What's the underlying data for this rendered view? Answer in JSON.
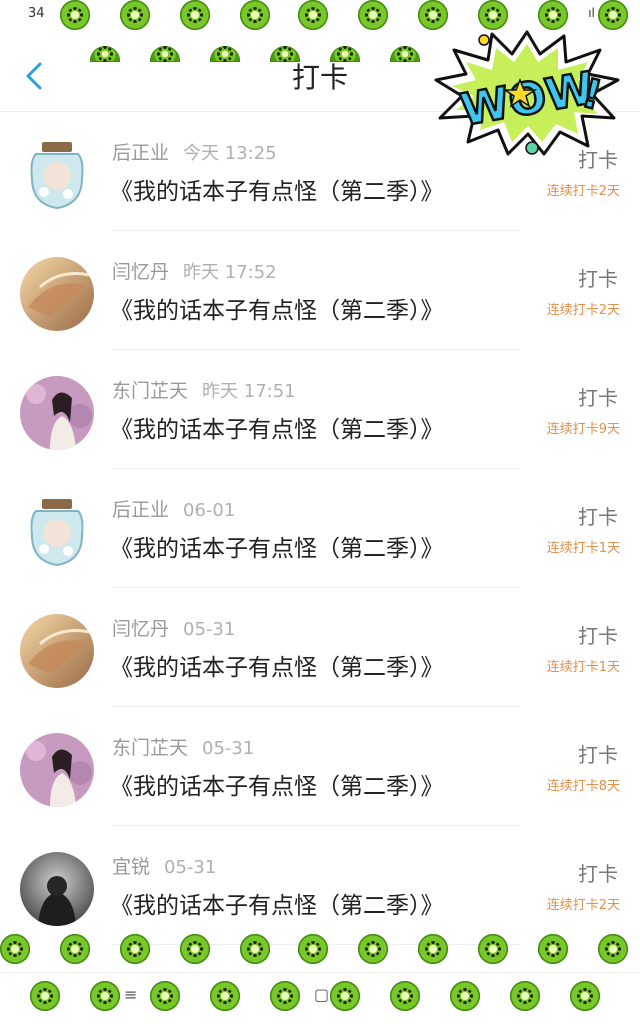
{
  "status_bar": {
    "time": "34",
    "icons": "ıl ✆ ◯"
  },
  "header": {
    "title": "打卡"
  },
  "sticker": {
    "text": "WOW!"
  },
  "items": [
    {
      "name": "后正业",
      "time": "今天 13:25",
      "book": "《我的话本子有点怪（第二季）》",
      "action": "打卡",
      "streak": "连续打卡2天",
      "avatar": "jar"
    },
    {
      "name": "闫忆丹",
      "time": "昨天 17:52",
      "book": "《我的话本子有点怪（第二季）》",
      "action": "打卡",
      "streak": "连续打卡2天",
      "avatar": "horse"
    },
    {
      "name": "东门芷天",
      "time": "昨天 17:51",
      "book": "《我的话本子有点怪（第二季）》",
      "action": "打卡",
      "streak": "连续打卡9天",
      "avatar": "girl"
    },
    {
      "name": "后正业",
      "time": "06-01",
      "book": "《我的话本子有点怪（第二季）》",
      "action": "打卡",
      "streak": "连续打卡1天",
      "avatar": "jar"
    },
    {
      "name": "闫忆丹",
      "time": "05-31",
      "book": "《我的话本子有点怪（第二季）》",
      "action": "打卡",
      "streak": "连续打卡1天",
      "avatar": "horse"
    },
    {
      "name": "东门芷天",
      "time": "05-31",
      "book": "《我的话本子有点怪（第二季）》",
      "action": "打卡",
      "streak": "连续打卡8天",
      "avatar": "girl"
    },
    {
      "name": "宜锐",
      "time": "05-31",
      "book": "《我的话本子有点怪（第二季）》",
      "action": "打卡",
      "streak": "连续打卡2天",
      "avatar": "dark"
    }
  ],
  "navbar": {
    "menu_icon": "≡",
    "home_icon": "▢"
  },
  "colors": {
    "accent_blue": "#2d9ee0",
    "streak_orange": "#e2904a"
  }
}
